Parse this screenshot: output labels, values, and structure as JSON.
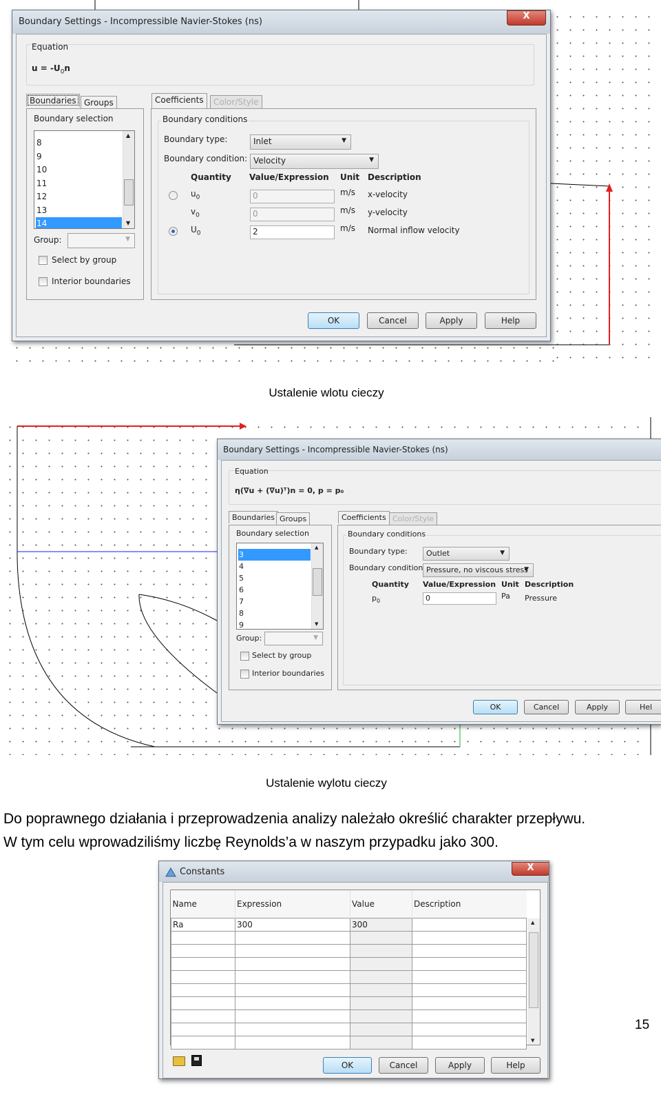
{
  "dialog1": {
    "title": "Boundary Settings - Incompressible Navier-Stokes (ns)",
    "close": "X",
    "equation_label": "Equation",
    "equation": {
      "main": "u = -U",
      "sub": "0",
      "tail": "n"
    },
    "tabs_left": [
      "Boundaries",
      "Groups"
    ],
    "tabs_right": [
      "Coefficients",
      "Color/Style"
    ],
    "boundary_selection_label": "Boundary selection",
    "boundary_items": [
      "8",
      "9",
      "10",
      "11",
      "12",
      "13",
      "14"
    ],
    "selected_item": "14",
    "group_label": "Group:",
    "select_by_group": "Select by group",
    "interior_boundaries": "Interior boundaries",
    "boundary_conditions_label": "Boundary conditions",
    "boundary_type_label": "Boundary type:",
    "boundary_type": "Inlet",
    "boundary_condition_label": "Boundary condition:",
    "boundary_condition": "Velocity",
    "headers": {
      "quantity": "Quantity",
      "value": "Value/Expression",
      "unit": "Unit",
      "description": "Description"
    },
    "rows": [
      {
        "q": "u",
        "sub": "0",
        "value": "0",
        "unit": "m/s",
        "desc": "x-velocity",
        "radio": "off",
        "enabled": false
      },
      {
        "q": "v",
        "sub": "0",
        "value": "0",
        "unit": "m/s",
        "desc": "y-velocity",
        "radio": "none",
        "enabled": false
      },
      {
        "q": "U",
        "sub": "0",
        "value": "2",
        "unit": "m/s",
        "desc": "Normal inflow velocity",
        "radio": "on",
        "enabled": true
      }
    ],
    "buttons": {
      "ok": "OK",
      "cancel": "Cancel",
      "apply": "Apply",
      "help": "Help"
    }
  },
  "caption1": "Ustalenie wlotu cieczy",
  "dialog2": {
    "title": "Boundary Settings - Incompressible Navier-Stokes (ns)",
    "equation_label": "Equation",
    "equation": "η(∇u + (∇u)ᵀ)n = 0, p = p₀",
    "tabs_left": [
      "Boundaries",
      "Groups"
    ],
    "tabs_right": [
      "Coefficients",
      "Color/Style"
    ],
    "boundary_selection_label": "Boundary selection",
    "boundary_items": [
      "3",
      "4",
      "5",
      "6",
      "7",
      "8",
      "9"
    ],
    "selected_item": "3",
    "group_label": "Group:",
    "select_by_group": "Select by group",
    "interior_boundaries": "Interior boundaries",
    "boundary_conditions_label": "Boundary conditions",
    "boundary_type_label": "Boundary type:",
    "boundary_type": "Outlet",
    "boundary_condition_label": "Boundary condition:",
    "boundary_condition": "Pressure, no viscous stress",
    "headers": {
      "quantity": "Quantity",
      "value": "Value/Expression",
      "unit": "Unit",
      "description": "Description"
    },
    "row": {
      "q": "p",
      "sub": "0",
      "value": "0",
      "unit": "Pa",
      "desc": "Pressure"
    },
    "buttons": {
      "ok": "OK",
      "cancel": "Cancel",
      "apply": "Apply",
      "help": "Hel"
    }
  },
  "caption2": "Ustalenie wylotu cieczy",
  "paragraph": [
    "Do poprawnego działania i przeprowadzenia analizy należało określić charakter przepływu.",
    "W tym celu wprowadziliśmy liczbę Reynolds’a w naszym przypadku jako 300."
  ],
  "constants": {
    "title": "Constants",
    "close": "X",
    "columns": [
      "Name",
      "Expression",
      "Value",
      "Description"
    ],
    "rows": [
      [
        "Ra",
        "300",
        "300",
        ""
      ]
    ],
    "empty_rows": 9,
    "icons": [
      "open-folder-icon",
      "save-icon"
    ],
    "buttons": {
      "ok": "OK",
      "cancel": "Cancel",
      "apply": "Apply",
      "help": "Help"
    }
  },
  "page_number": "15",
  "colors": {
    "arrow": "#e02020",
    "selection": "#3399ff",
    "blue_line": "#1a1aff"
  }
}
